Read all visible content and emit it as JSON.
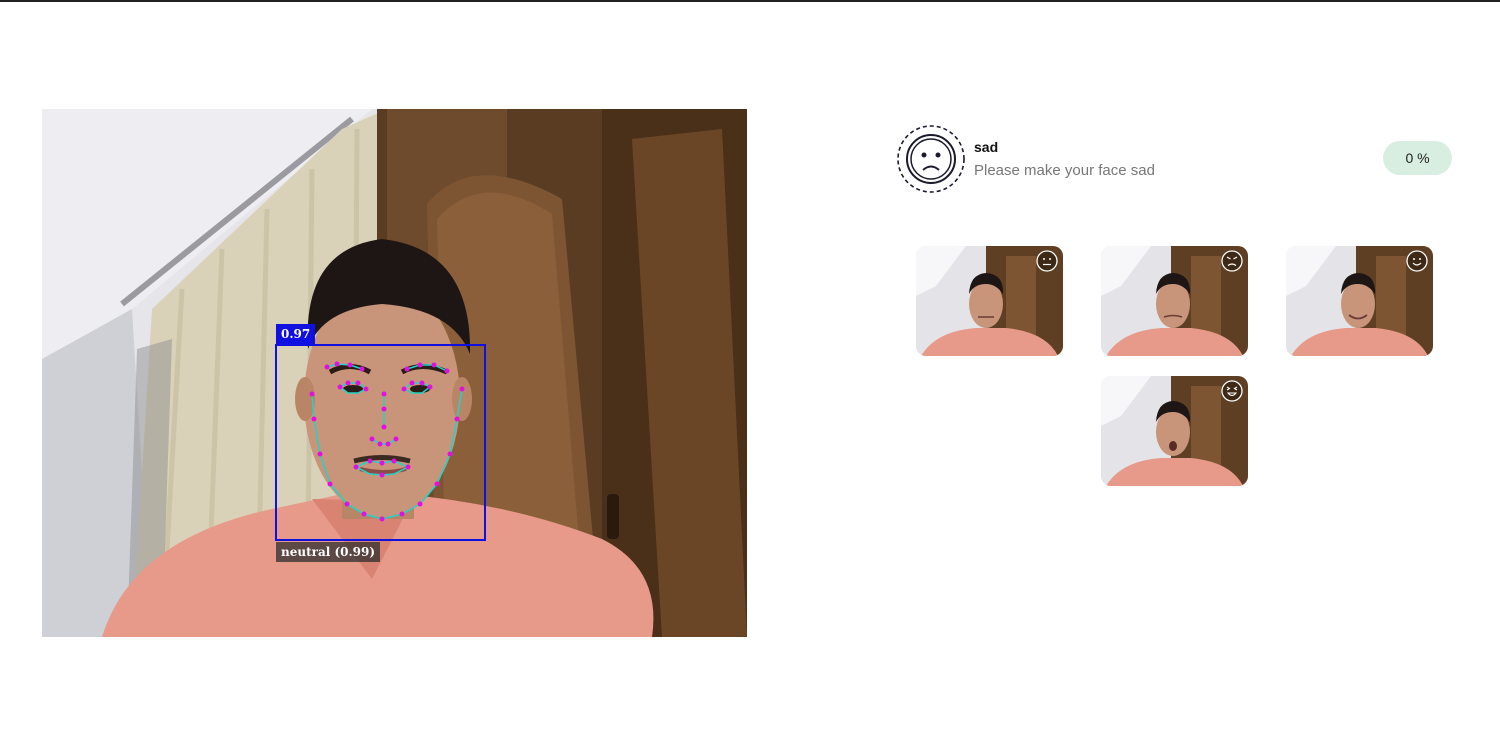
{
  "detection": {
    "score_label": "0.97",
    "expression_label": "neutral (0.99)"
  },
  "task": {
    "icon": "sad-face-icon",
    "title": "sad",
    "description": "Please make your face sad",
    "progress": "0 %"
  },
  "captures": [
    {
      "emotion_icon": "neutral-face-icon"
    },
    {
      "emotion_icon": "angry-face-icon"
    },
    {
      "emotion_icon": "happy-face-icon"
    },
    {
      "emotion_icon": "surprised-face-icon"
    }
  ],
  "colors": {
    "box": "#1010e0",
    "landmark_point": "#e011e0",
    "landmark_line": "#22d3c5",
    "progress_bg": "#d7eee0"
  }
}
